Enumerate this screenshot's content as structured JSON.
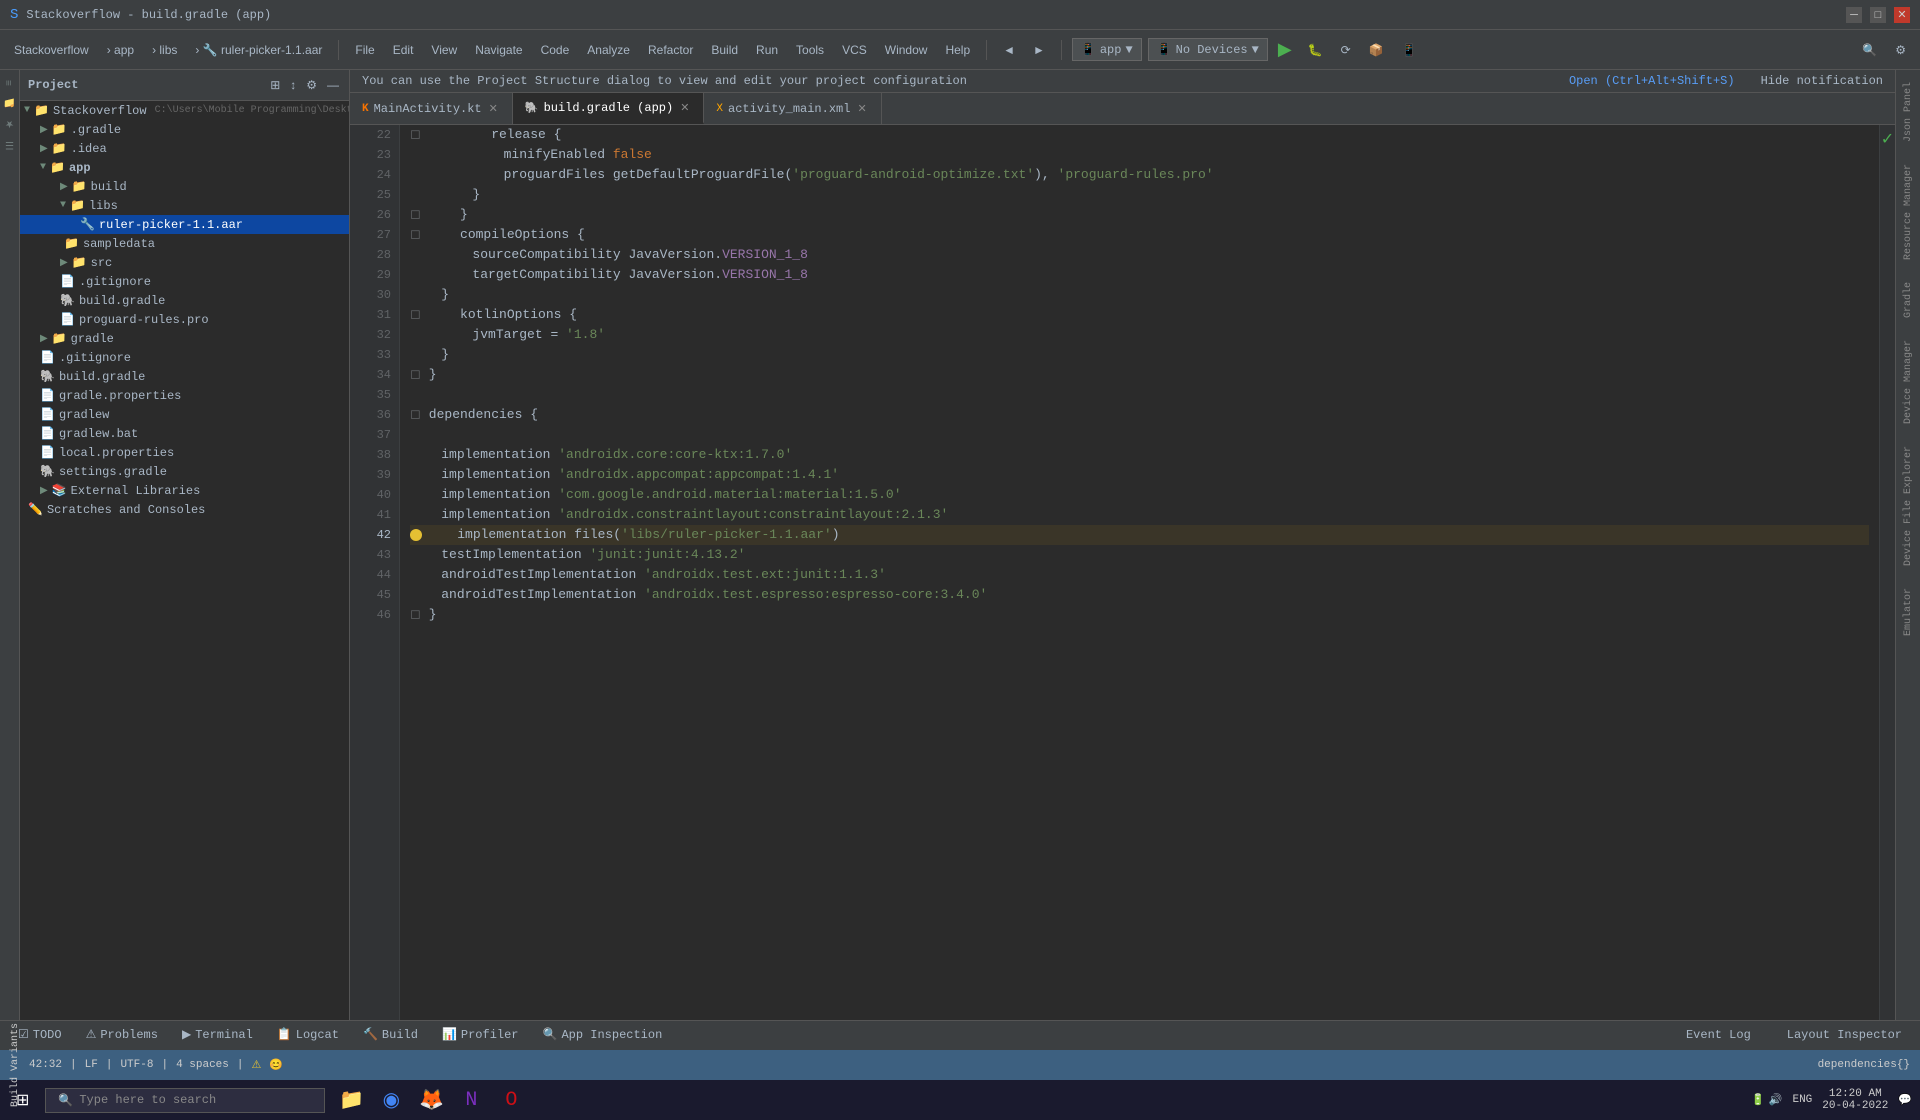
{
  "app": {
    "title": "Stackoverflow - build.gradle (app)",
    "project_name": "Stackoverflow"
  },
  "breadcrumb": {
    "items": [
      "app",
      "libs",
      "ruler-picker-1.1.aar"
    ]
  },
  "toolbar": {
    "app_selector": "app",
    "device_selector": "No Devices",
    "run_label": "▶",
    "search_placeholder": "Search"
  },
  "tabs": [
    {
      "id": "tab-mainactivity",
      "label": "MainActivity.kt",
      "icon": "kt",
      "active": false
    },
    {
      "id": "tab-buildgradle",
      "label": "build.gradle (app)",
      "icon": "gradle",
      "active": true
    },
    {
      "id": "tab-activitymain",
      "label": "activity_main.xml",
      "icon": "xml",
      "active": false
    }
  ],
  "notification": {
    "message": "You can use the Project Structure dialog to view and edit your project configuration",
    "action_label": "Open (Ctrl+Alt+Shift+S)",
    "hide_label": "Hide notification"
  },
  "project_panel": {
    "title": "Project",
    "items": [
      {
        "id": "stackoverflow-root",
        "label": "Stackoverflow",
        "indent": 0,
        "type": "root",
        "expanded": true
      },
      {
        "id": "gradle-dir",
        "label": ".gradle",
        "indent": 1,
        "type": "folder",
        "expanded": false
      },
      {
        "id": "idea-dir",
        "label": ".idea",
        "indent": 1,
        "type": "folder",
        "expanded": false
      },
      {
        "id": "app-dir",
        "label": "app",
        "indent": 1,
        "type": "folder",
        "expanded": true
      },
      {
        "id": "build-dir",
        "label": "build",
        "indent": 2,
        "type": "folder",
        "expanded": false
      },
      {
        "id": "libs-dir",
        "label": "libs",
        "indent": 2,
        "type": "folder",
        "expanded": true
      },
      {
        "id": "ruler-picker",
        "label": "ruler-picker-1.1.aar",
        "indent": 3,
        "type": "aar",
        "selected": true
      },
      {
        "id": "sampledata-dir",
        "label": "sampledata",
        "indent": 2,
        "type": "folder",
        "expanded": false
      },
      {
        "id": "src-dir",
        "label": "src",
        "indent": 2,
        "type": "folder",
        "expanded": false
      },
      {
        "id": "gitignore-app",
        "label": ".gitignore",
        "indent": 2,
        "type": "file"
      },
      {
        "id": "buildgradle-app",
        "label": "build.gradle",
        "indent": 2,
        "type": "gradle"
      },
      {
        "id": "proguard",
        "label": "proguard-rules.pro",
        "indent": 2,
        "type": "file"
      },
      {
        "id": "gradle-root",
        "label": "gradle",
        "indent": 1,
        "type": "folder",
        "expanded": false
      },
      {
        "id": "gitignore-root",
        "label": ".gitignore",
        "indent": 1,
        "type": "file"
      },
      {
        "id": "buildgradle-root",
        "label": "build.gradle",
        "indent": 1,
        "type": "gradle"
      },
      {
        "id": "gradle-props",
        "label": "gradle.properties",
        "indent": 1,
        "type": "file"
      },
      {
        "id": "gradlew",
        "label": "gradlew",
        "indent": 1,
        "type": "file"
      },
      {
        "id": "gradlew-bat",
        "label": "gradlew.bat",
        "indent": 1,
        "type": "file"
      },
      {
        "id": "local-props",
        "label": "local.properties",
        "indent": 1,
        "type": "file"
      },
      {
        "id": "settings-gradle",
        "label": "settings.gradle",
        "indent": 1,
        "type": "gradle"
      },
      {
        "id": "external-libs",
        "label": "External Libraries",
        "indent": 1,
        "type": "folder",
        "expanded": false
      },
      {
        "id": "scratches",
        "label": "Scratches and Consoles",
        "indent": 0,
        "type": "folder",
        "expanded": false
      }
    ]
  },
  "code": {
    "lines": [
      {
        "num": 22,
        "content": "        release {",
        "type": "plain"
      },
      {
        "num": 23,
        "content": "            minifyEnabled false",
        "type": "mixed"
      },
      {
        "num": 24,
        "content": "            proguardFiles getDefaultProguardFile('proguard-android-optimize.txt'), 'proguard-rules.pro'",
        "type": "mixed"
      },
      {
        "num": 25,
        "content": "        }",
        "type": "plain"
      },
      {
        "num": 26,
        "content": "    }",
        "type": "plain"
      },
      {
        "num": 27,
        "content": "    compileOptions {",
        "type": "plain"
      },
      {
        "num": 28,
        "content": "        sourceCompatibility JavaVersion.VERSION_1_8",
        "type": "mixed"
      },
      {
        "num": 29,
        "content": "        targetCompatibility JavaVersion.VERSION_1_8",
        "type": "mixed"
      },
      {
        "num": 30,
        "content": "    }",
        "type": "plain"
      },
      {
        "num": 31,
        "content": "    kotlinOptions {",
        "type": "plain"
      },
      {
        "num": 32,
        "content": "        jvmTarget = '1.8'",
        "type": "mixed"
      },
      {
        "num": 33,
        "content": "    }",
        "type": "plain"
      },
      {
        "num": 34,
        "content": "}",
        "type": "plain"
      },
      {
        "num": 35,
        "content": "",
        "type": "blank"
      },
      {
        "num": 36,
        "content": "dependencies {",
        "type": "plain"
      },
      {
        "num": 37,
        "content": "",
        "type": "blank"
      },
      {
        "num": 38,
        "content": "    implementation 'androidx.core:core-ktx:1.7.0'",
        "type": "mixed"
      },
      {
        "num": 39,
        "content": "    implementation 'androidx.appcompat:appcompat:1.4.1'",
        "type": "mixed"
      },
      {
        "num": 40,
        "content": "    implementation 'com.google.android.material:material:1.5.0'",
        "type": "mixed"
      },
      {
        "num": 41,
        "content": "    implementation 'androidx.constraintlayout:constraintlayout:2.1.3'",
        "type": "mixed"
      },
      {
        "num": 42,
        "content": "    implementation files('libs/ruler-picker-1.1.aar')",
        "type": "warning",
        "warning": true
      },
      {
        "num": 43,
        "content": "    testImplementation 'junit:junit:4.13.2'",
        "type": "mixed"
      },
      {
        "num": 44,
        "content": "    androidTestImplementation 'androidx.test.ext:junit:1.1.3'",
        "type": "mixed"
      },
      {
        "num": 45,
        "content": "    androidTestImplementation 'androidx.test.espresso:espresso-core:3.4.0'",
        "type": "mixed"
      },
      {
        "num": 46,
        "content": "}",
        "type": "plain"
      }
    ],
    "status_bar_text": "dependencies{}"
  },
  "bottom_tabs": [
    {
      "id": "tab-todo",
      "label": "TODO",
      "icon": "☑",
      "active": false
    },
    {
      "id": "tab-problems",
      "label": "Problems",
      "icon": "⚠",
      "active": false
    },
    {
      "id": "tab-terminal",
      "label": "Terminal",
      "icon": "⬛",
      "active": false
    },
    {
      "id": "tab-logcat",
      "label": "Logcat",
      "icon": "📋",
      "active": false
    },
    {
      "id": "tab-build",
      "label": "Build",
      "icon": "🔨",
      "active": false
    },
    {
      "id": "tab-profiler",
      "label": "Profiler",
      "icon": "📊",
      "active": false
    },
    {
      "id": "tab-appinspection",
      "label": "App Inspection",
      "icon": "🔍",
      "active": false
    }
  ],
  "bottom_right_tabs": [
    {
      "id": "tab-eventlog",
      "label": "Event Log",
      "active": false
    },
    {
      "id": "tab-layoutinspector",
      "label": "Layout Inspector",
      "active": false
    }
  ],
  "status_bar": {
    "position": "42:32",
    "line_ending": "LF",
    "encoding": "UTF-8",
    "indent": "4 spaces"
  },
  "taskbar": {
    "search_placeholder": "Type here to search",
    "time": "12:20 AM",
    "date": "20-04-2022",
    "language": "ENG"
  },
  "right_panels": [
    {
      "id": "panel-json",
      "label": "Json Panel"
    },
    {
      "id": "panel-resource-manager",
      "label": "Resource Manager"
    },
    {
      "id": "panel-gradle",
      "label": "Gradle"
    },
    {
      "id": "panel-device-manager",
      "label": "Device Manager"
    },
    {
      "id": "panel-file-explorer",
      "label": "Device File Explorer"
    },
    {
      "id": "panel-emulator",
      "label": "Emulator"
    }
  ]
}
